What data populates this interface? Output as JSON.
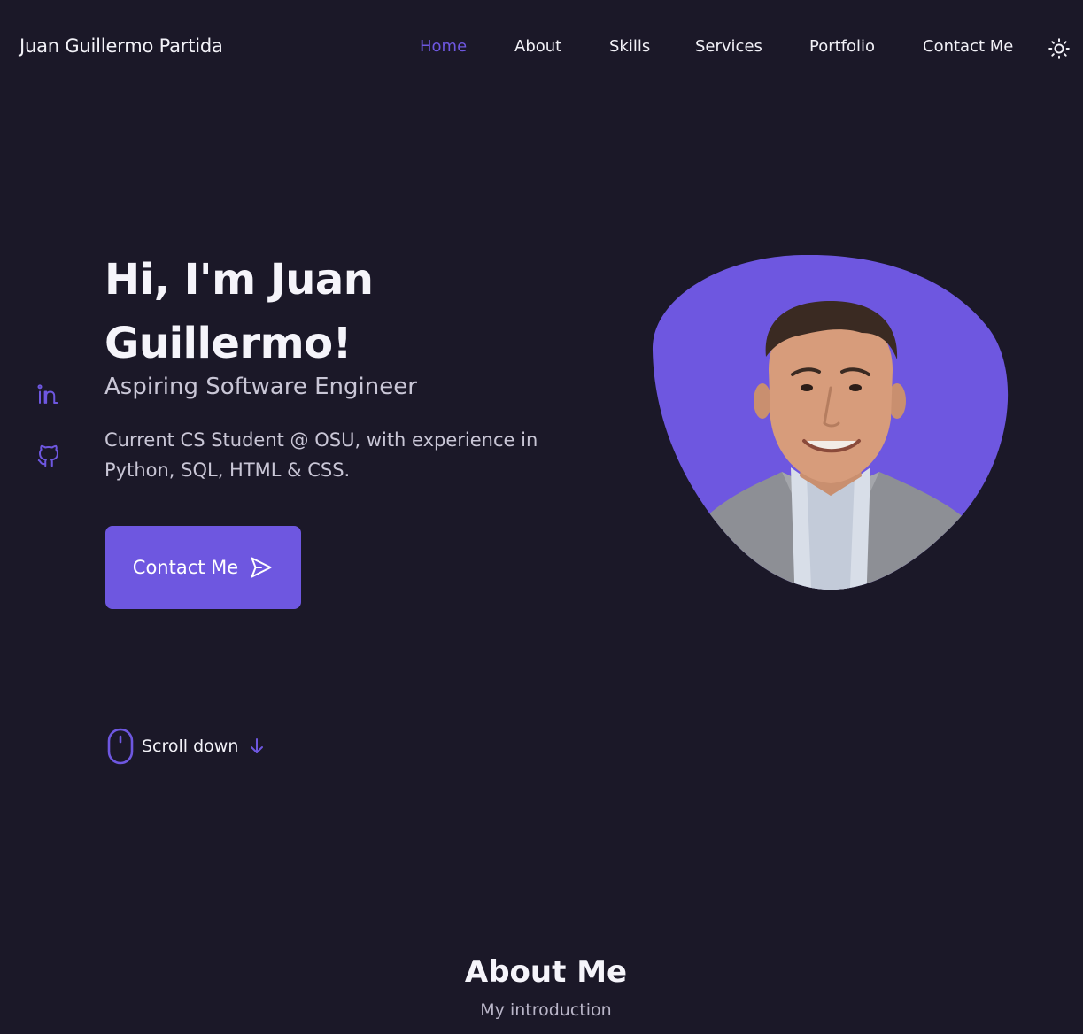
{
  "header": {
    "logo": "Juan Guillermo Partida",
    "nav": [
      {
        "label": "Home",
        "active": true
      },
      {
        "label": "About",
        "active": false
      },
      {
        "label": "Skills",
        "active": false
      },
      {
        "label": "Services",
        "active": false
      },
      {
        "label": "Portfolio",
        "active": false
      },
      {
        "label": "Contact Me",
        "active": false
      }
    ],
    "theme_icon": "sun-icon"
  },
  "hero": {
    "title_line1": "Hi, I'm Juan",
    "title_line2": "Guillermo!",
    "subtitle": "Aspiring Software Engineer",
    "description": "Current CS Student @ OSU, with experience in Python, SQL, HTML & CSS.",
    "button_label": "Contact Me",
    "button_icon": "send-icon",
    "social": [
      {
        "icon": "linkedin-icon"
      },
      {
        "icon": "github-icon"
      }
    ],
    "scroll_label": "Scroll down",
    "scroll_icon": "mouse-icon",
    "scroll_arrow_icon": "arrow-down-icon",
    "profile_image": "profile-photo"
  },
  "about": {
    "title": "About Me",
    "subtitle": "My introduction"
  },
  "colors": {
    "background": "#1b1828",
    "accent": "#6e57e0",
    "text": "#f2f1f7",
    "muted": "#c9c6d6"
  }
}
